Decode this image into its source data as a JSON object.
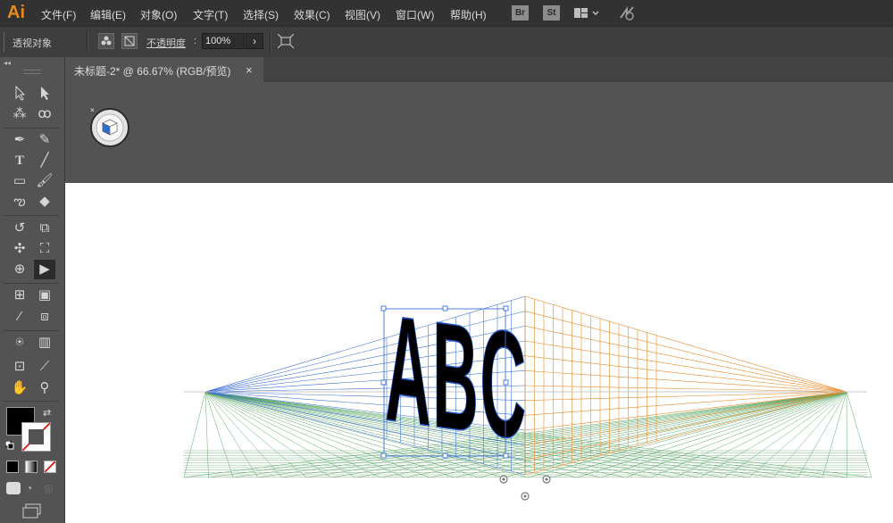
{
  "app": {
    "logo": "Ai"
  },
  "menu": [
    "文件(F)",
    "编辑(E)",
    "对象(O)",
    "文字(T)",
    "选择(S)",
    "效果(C)",
    "视图(V)",
    "窗口(W)",
    "帮助(H)"
  ],
  "menu_badges": {
    "bridge": "Br",
    "stock": "St"
  },
  "control": {
    "object_label": "透视对象",
    "opacity_label": "不透明度",
    "opacity_colon": ":",
    "opacity_value": "100%",
    "opacity_arrow": "›"
  },
  "tab": {
    "title": "未标题-2* @ 66.67% (RGB/预览)",
    "close": "×"
  },
  "artwork": {
    "text": "ABC"
  },
  "colors": {
    "ai_orange": "#e8891c",
    "grid_left": "#3a6fd8",
    "grid_right": "#e88a2a",
    "grid_ground": "#4ea05a",
    "fill": "#000000"
  },
  "icons": [
    "selection-icon",
    "direct-selection-icon",
    "magic-wand-icon",
    "lasso-icon",
    "pen-icon",
    "curvature-icon",
    "type-icon",
    "line-icon",
    "rectangle-icon",
    "paintbrush-icon",
    "shaper-icon",
    "eraser-icon",
    "rotate-icon",
    "scale-icon",
    "puppet-warp-icon",
    "free-transform-icon",
    "shape-builder-icon",
    "perspective-selection-icon",
    "mesh-icon",
    "gradient-icon",
    "eyedropper-icon",
    "blend-icon",
    "symbol-sprayer-icon",
    "column-graph-icon",
    "artboard-icon",
    "slice-icon",
    "hand-icon",
    "zoom-icon"
  ]
}
